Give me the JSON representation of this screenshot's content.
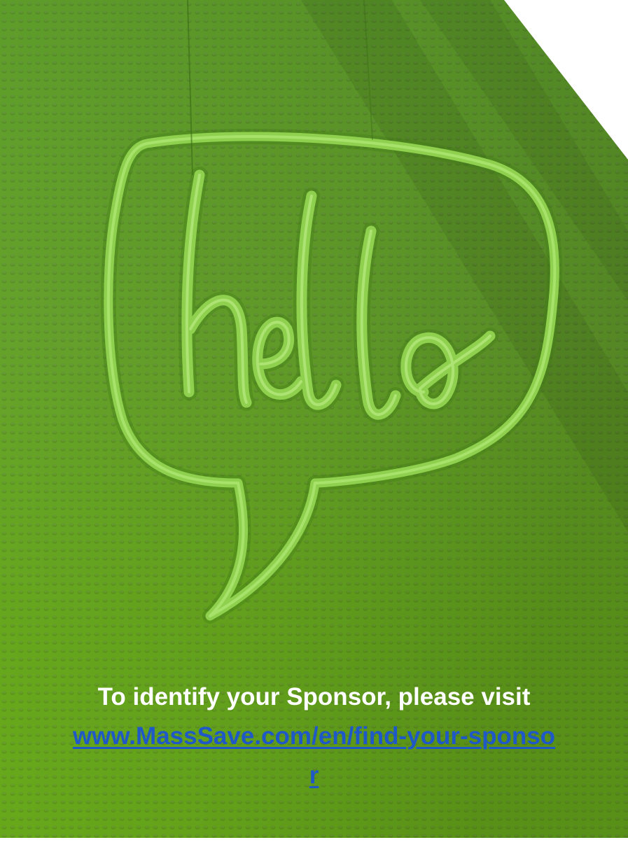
{
  "sign": {
    "word": "hello",
    "icon": "speech-bubble-icon"
  },
  "caption": {
    "lead_text": "To identify your Sponsor, please visit",
    "link_text": "www.MassSave.com/en/find-your-sponsor"
  },
  "colors": {
    "background_green": "#67a52c",
    "neon_green": "#8fd14f",
    "link_blue": "#1e59c7",
    "text_white": "#ffffff"
  }
}
